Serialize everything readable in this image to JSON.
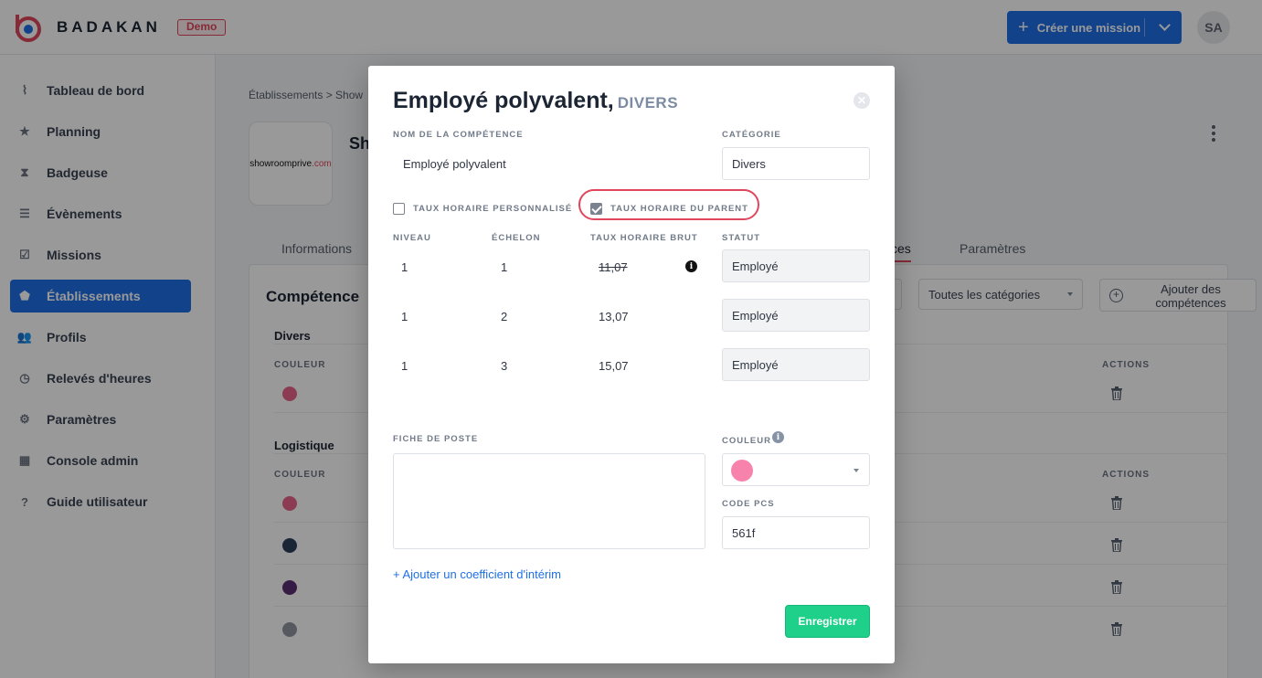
{
  "app": {
    "brand": "BADAKAN",
    "badge": "Demo",
    "create_button": "Créer une mission",
    "avatar_initials": "SA"
  },
  "sidebar": {
    "items": [
      {
        "label": "Tableau de bord",
        "icon": "pulse-icon"
      },
      {
        "label": "Planning",
        "icon": "calendar-star-icon"
      },
      {
        "label": "Badgeuse",
        "icon": "hourglass-icon"
      },
      {
        "label": "Évènements",
        "icon": "list-icon"
      },
      {
        "label": "Missions",
        "icon": "clipboard-check-icon"
      },
      {
        "label": "Établissements",
        "icon": "home-icon",
        "active": true
      },
      {
        "label": "Profils",
        "icon": "users-icon"
      },
      {
        "label": "Relevés d'heures",
        "icon": "clock-icon"
      },
      {
        "label": "Paramètres",
        "icon": "gear-icon"
      },
      {
        "label": "Console admin",
        "icon": "grid-icon"
      },
      {
        "label": "Guide utilisateur",
        "icon": "question-icon"
      }
    ]
  },
  "page": {
    "breadcrumb": "Établissements > Show",
    "establishment_logo_text": "showroomprive",
    "establishment_logo_suffix": ".com",
    "establishment_title": "Sh",
    "tabs": [
      {
        "label": "Informations"
      },
      {
        "label": "ces"
      },
      {
        "label": "Paramètres"
      }
    ],
    "panel_title": "Compétence",
    "category_filter": "Toutes les catégories",
    "add_competences": "Ajouter des compétences",
    "groups": [
      {
        "title": "Divers",
        "color_header": "COULEUR",
        "actions_header": "ACTIONS",
        "rows": [
          {
            "color": "#e8658b"
          }
        ]
      },
      {
        "title": "Logistique",
        "color_header": "COULEUR",
        "actions_header": "ACTIONS",
        "rows": [
          {
            "color": "#e8658b"
          },
          {
            "color": "#2c3e5a"
          },
          {
            "color": "#5b2d74"
          },
          {
            "color": "#8f96a0"
          }
        ]
      }
    ]
  },
  "modal": {
    "title": "Employé polyvalent,",
    "title_category": "DIVERS",
    "close_icon": "close-icon",
    "name_label": "NOM DE LA COMPÉTENCE",
    "name_value": "Employé polyvalent",
    "category_label": "CATÉGORIE",
    "category_value": "Divers",
    "custom_rate_label": "TAUX HORAIRE PERSONNALISÉ",
    "custom_rate_checked": false,
    "parent_rate_label": "TAUX HORAIRE DU PARENT",
    "parent_rate_checked": true,
    "headers": {
      "niveau": "NIVEAU",
      "echelon": "ÉCHELON",
      "taux": "TAUX HORAIRE BRUT",
      "statut": "STATUT"
    },
    "rows": [
      {
        "niveau": "1",
        "echelon": "1",
        "taux": "11,07",
        "struck": true,
        "statut": "Employé"
      },
      {
        "niveau": "1",
        "echelon": "2",
        "taux": "13,07",
        "struck": false,
        "statut": "Employé"
      },
      {
        "niveau": "1",
        "echelon": "3",
        "taux": "15,07",
        "struck": false,
        "statut": "Employé"
      }
    ],
    "info_glyph": "i",
    "job_sheet_label": "FICHE DE POSTE",
    "job_sheet_value": "",
    "color_label": "COULEUR",
    "color_value": "#f783ad",
    "pcs_label": "CODE PCS",
    "pcs_value": "561f",
    "add_coefficient": "+ Ajouter un coefficient d'intérim",
    "save_button": "Enregistrer"
  },
  "colors": {
    "primary": "#1f6fe5",
    "accent_red": "#e0475c",
    "success": "#1ed08a"
  }
}
